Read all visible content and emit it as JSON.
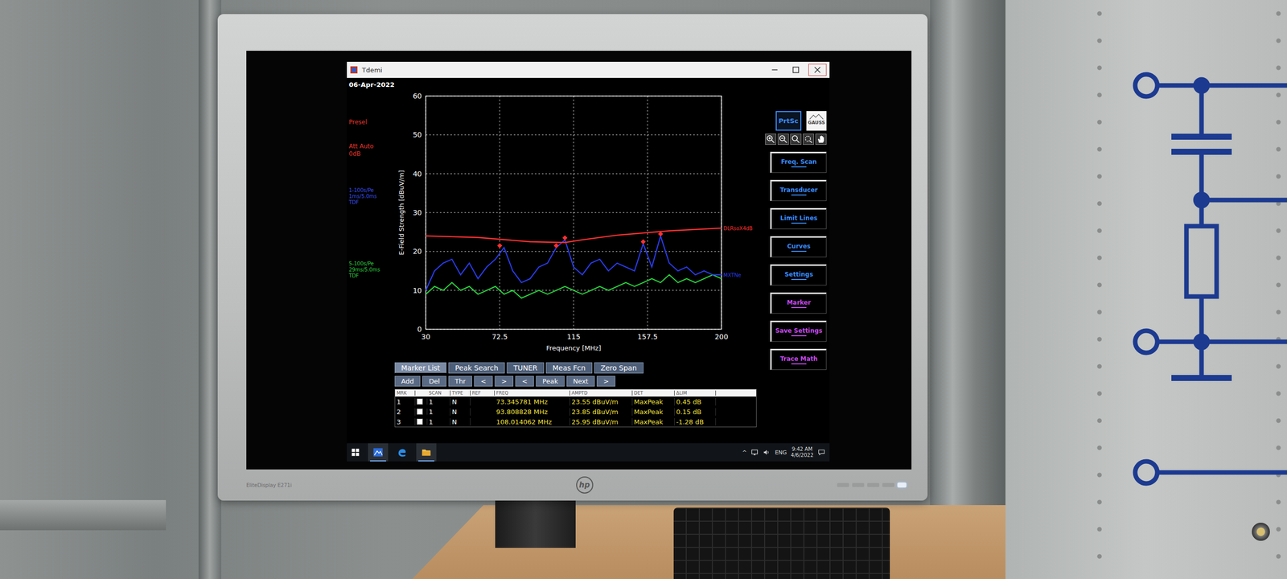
{
  "window": {
    "title": "Tdemi",
    "date": "06-Apr-2022"
  },
  "monitor": {
    "logo": "hp",
    "model": "EliteDisplay E271i"
  },
  "side_labels": [
    {
      "color": "#e8352c",
      "lines": [
        "Presel"
      ]
    },
    {
      "color": "#e8352c",
      "lines": [
        "Att Auto",
        "0dB"
      ]
    },
    {
      "color": "#3b4ff0",
      "lines": [
        "1-100s/Pe",
        "1ms/5.0ms",
        "TDF"
      ]
    },
    {
      "color": "#2fd040",
      "lines": [
        "5-100s/Pe",
        "29ms/5.0ms",
        "TDF"
      ]
    }
  ],
  "chart": {
    "y_axis_title": "E-Field Strength [dBuV/m]",
    "x_axis_title": "Frequency [MHz]",
    "y_ticks": [
      "0",
      "10",
      "20",
      "30",
      "40",
      "50",
      "60"
    ],
    "x_ticks": [
      "30",
      "72.5",
      "115",
      "157.5",
      "200"
    ],
    "series": [
      {
        "label": "MXTNe",
        "color": "#2a3cf0",
        "values": [
          10,
          15,
          17,
          18,
          14,
          17,
          13,
          16,
          18,
          21,
          15,
          12,
          13,
          16,
          17,
          21,
          23,
          16,
          14,
          17,
          18,
          15,
          17,
          16,
          15,
          22,
          16,
          24,
          17,
          15,
          16,
          14,
          15,
          14,
          14
        ]
      },
      {
        "color": "#28d23c",
        "values": [
          9,
          11,
          10,
          12,
          10,
          11,
          9,
          10,
          11,
          9,
          10,
          8,
          9,
          10,
          9,
          10,
          11,
          10,
          9,
          10,
          11,
          10,
          11,
          12,
          11,
          12,
          13,
          12,
          14,
          12,
          13,
          12,
          13,
          14,
          13
        ]
      }
    ],
    "limit": {
      "label": "DLRsoX4dB",
      "color": "#ff3030",
      "freqs": [
        30,
        60,
        90,
        110,
        120,
        140,
        170,
        200
      ],
      "values": [
        24,
        23.6,
        22.5,
        22.3,
        23,
        24.2,
        25.3,
        26
      ]
    },
    "markers": [
      {
        "freq": 72.5,
        "level": 21.5
      },
      {
        "freq": 105,
        "level": 21.5
      },
      {
        "freq": 110,
        "level": 23.5
      },
      {
        "freq": 155,
        "level": 22.5
      },
      {
        "freq": 165,
        "level": 24.5
      }
    ]
  },
  "sidebar": {
    "prtsc": "PrtSc",
    "logo": "GAUSS",
    "buttons": [
      {
        "label": "Freq. Scan",
        "color": "#3a8cff"
      },
      {
        "label": "Transducer",
        "color": "#3a8cff"
      },
      {
        "label": "Limit Lines",
        "color": "#3a8cff"
      },
      {
        "label": "Curves",
        "color": "#3a8cff"
      },
      {
        "label": "Settings",
        "color": "#3a8cff"
      },
      {
        "label": "Marker",
        "color": "#c848f0"
      },
      {
        "label": "Save Settings",
        "color": "#c848f0"
      },
      {
        "label": "Trace Math",
        "color": "#c848f0"
      }
    ]
  },
  "tabs": [
    {
      "label": "Marker List",
      "selected": true
    },
    {
      "label": "Peak Search",
      "selected": false
    },
    {
      "label": "TUNER",
      "selected": false
    },
    {
      "label": "Meas Fcn",
      "selected": false
    },
    {
      "label": "Zero Span",
      "selected": false
    }
  ],
  "toolbar": [
    "Add",
    "Del",
    "Thr",
    "<",
    ">",
    "<",
    "Peak",
    "Next",
    ">"
  ],
  "table": {
    "columns": [
      "MRK",
      "SCAN",
      "TYPE",
      "REF",
      "FREQ",
      "AMPTD",
      "DET",
      "ΔLIM"
    ],
    "rows": [
      {
        "checked": false,
        "cells": [
          "1",
          "1",
          "N",
          "",
          "73.345781 MHz",
          "23.55 dBuV/m",
          "MaxPeak",
          "0.45 dB"
        ]
      },
      {
        "checked": false,
        "cells": [
          "2",
          "1",
          "N",
          "",
          "93.808828 MHz",
          "23.85 dBuV/m",
          "MaxPeak",
          "0.15 dB"
        ]
      },
      {
        "checked": false,
        "cells": [
          "3",
          "1",
          "N",
          "",
          "108.014062 MHz",
          "25.95 dBuV/m",
          "MaxPeak",
          "-1.28 dB"
        ]
      }
    ]
  },
  "taskbar": {
    "apps": [
      {
        "kind": "gauss",
        "selected": true
      },
      {
        "kind": "edge",
        "selected": false
      },
      {
        "kind": "explorer",
        "selected": true
      }
    ],
    "chevron": "^",
    "language": "ENG",
    "time": "9:42 AM",
    "date": "4/6/2022"
  }
}
